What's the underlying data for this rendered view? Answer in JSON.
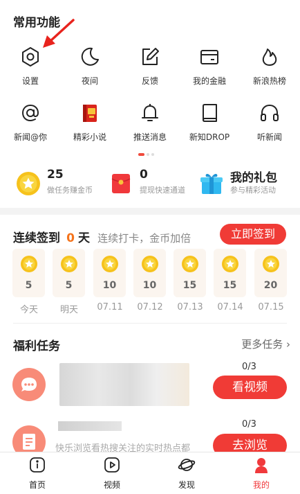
{
  "common": {
    "title": "常用功能",
    "items": [
      {
        "label": "设置",
        "icon": "gear-icon"
      },
      {
        "label": "夜间",
        "icon": "moon-icon"
      },
      {
        "label": "反馈",
        "icon": "edit-icon"
      },
      {
        "label": "我的金融",
        "icon": "card-icon"
      },
      {
        "label": "新浪热榜",
        "icon": "flame-icon"
      },
      {
        "label": "新闻@你",
        "icon": "at-icon"
      },
      {
        "label": "精彩小说",
        "icon": "novel-book-icon"
      },
      {
        "label": "推送消息",
        "icon": "bell-icon"
      },
      {
        "label": "新知DROP",
        "icon": "book-icon"
      },
      {
        "label": "听新闻",
        "icon": "headphones-icon"
      }
    ]
  },
  "assets": [
    {
      "value": "25",
      "sub": "做任务赚金币",
      "icon": "gold-coin-icon"
    },
    {
      "value": "0",
      "sub": "提现快速通道",
      "icon": "red-envelope-icon"
    },
    {
      "value": "我的礼包",
      "sub": "参与精彩活动",
      "icon": "gift-icon"
    }
  ],
  "checkin": {
    "title_prefix": "连续签到",
    "days_count": "0",
    "days_unit": "天",
    "subtitle": "连续打卡，金币加倍",
    "button": "立即签到",
    "days": [
      {
        "value": "5",
        "label": "今天"
      },
      {
        "value": "5",
        "label": "明天"
      },
      {
        "value": "10",
        "label": "07.11"
      },
      {
        "value": "10",
        "label": "07.12"
      },
      {
        "value": "15",
        "label": "07.13"
      },
      {
        "value": "15",
        "label": "07.14"
      },
      {
        "value": "20",
        "label": "07.15"
      }
    ]
  },
  "tasks": {
    "title": "福利任务",
    "more": "更多任务 ›",
    "items": [
      {
        "progress": "0/3",
        "button": "看视频",
        "icon": "chat-bubble-icon",
        "desc": ""
      },
      {
        "progress": "0/3",
        "button": "去浏览",
        "icon": "document-icon",
        "desc": "快乐浏览看热搜关注的实时热点都"
      }
    ]
  },
  "tabbar": [
    {
      "label": "首页",
      "icon": "info-box-icon"
    },
    {
      "label": "视频",
      "icon": "play-icon"
    },
    {
      "label": "发现",
      "icon": "planet-icon"
    },
    {
      "label": "我的",
      "icon": "profile-icon"
    }
  ],
  "colors": {
    "accent": "#f03b36",
    "coin": "#f5b915",
    "background": "#f3f3f3"
  }
}
